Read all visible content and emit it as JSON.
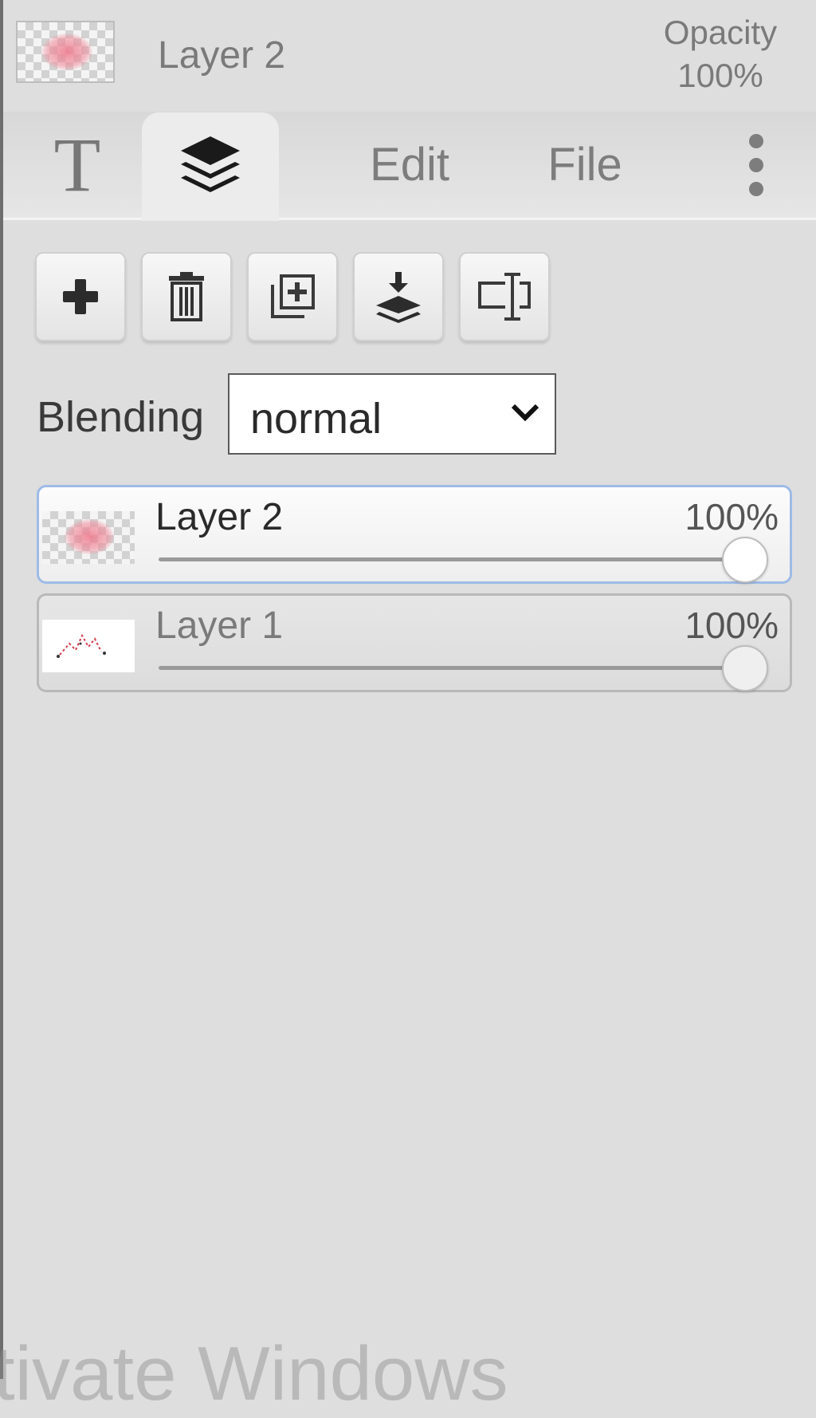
{
  "header": {
    "layer_name": "Layer 2",
    "opacity_label": "Opacity",
    "opacity_value": "100%"
  },
  "tabs": [
    {
      "label": "T",
      "icon": "text-icon",
      "active": false
    },
    {
      "label": "",
      "icon": "layers-icon",
      "active": true
    },
    {
      "label": "Edit",
      "active": false
    },
    {
      "label": "File",
      "active": false
    },
    {
      "label": "",
      "icon": "more-vertical-icon",
      "active": false
    }
  ],
  "toolbar": {
    "buttons": [
      {
        "icon": "plus-icon"
      },
      {
        "icon": "trash-icon"
      },
      {
        "icon": "duplicate-icon"
      },
      {
        "icon": "merge-down-icon"
      },
      {
        "icon": "rename-icon"
      }
    ]
  },
  "blending": {
    "label": "Blending",
    "value": "normal"
  },
  "layers": [
    {
      "name": "Layer 2",
      "opacity_text": "100%",
      "opacity": 1.0,
      "selected": true
    },
    {
      "name": "Layer 1",
      "opacity_text": "100%",
      "opacity": 1.0,
      "selected": false
    }
  ],
  "watermark": "tivate Windows",
  "colors": {
    "panel_bg": "#dedede",
    "selected_border": "#9ebbe6",
    "text_dark": "#2a2a2a",
    "text_muted": "#7a7a7a"
  }
}
